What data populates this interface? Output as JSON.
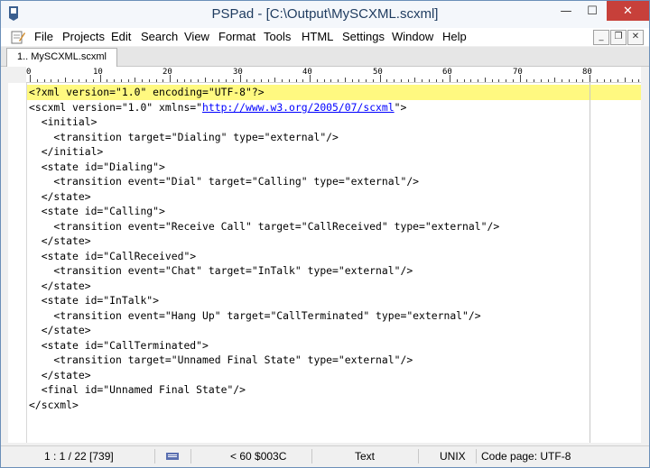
{
  "window": {
    "title": "PSPad - [C:\\Output\\MySCXML.scxml]"
  },
  "controls": {
    "minimize": "—",
    "maximize": "☐",
    "close": "✕"
  },
  "mdi_controls": {
    "minimize": "_",
    "restore": "❐",
    "close": "✕"
  },
  "menu": [
    "File",
    "Projects",
    "Edit",
    "Search",
    "View",
    "Format",
    "Tools",
    "HTML",
    "Settings",
    "Window",
    "Help"
  ],
  "tabs": [
    {
      "label": "1.. MySCXML.scxml"
    }
  ],
  "ruler": {
    "labels": [
      "0",
      "10",
      "20",
      "30",
      "40",
      "50",
      "60",
      "70",
      "80"
    ]
  },
  "code": {
    "lines": [
      "<?xml version=\"1.0\" encoding=\"UTF-8\"?>",
      "<scxml version=\"1.0\" xmlns=\"",
      "  <initial>",
      "    <transition target=\"Dialing\" type=\"external\"/>",
      "  </initial>",
      "  <state id=\"Dialing\">",
      "    <transition event=\"Dial\" target=\"Calling\" type=\"external\"/>",
      "  </state>",
      "  <state id=\"Calling\">",
      "    <transition event=\"Receive Call\" target=\"CallReceived\" type=\"external\"/>",
      "  </state>",
      "  <state id=\"CallReceived\">",
      "    <transition event=\"Chat\" target=\"InTalk\" type=\"external\"/>",
      "  </state>",
      "  <state id=\"InTalk\">",
      "    <transition event=\"Hang Up\" target=\"CallTerminated\" type=\"external\"/>",
      "  </state>",
      "  <state id=\"CallTerminated\">",
      "    <transition target=\"Unnamed Final State\" type=\"external\"/>",
      "  </state>",
      "  <final id=\"Unnamed Final State\"/>",
      "</scxml>"
    ],
    "link_text": "http://www.w3.org/2005/07/scxml",
    "link_suffix": "\">"
  },
  "status": {
    "position": "1 : 1 / 22 [739]",
    "char_info": "<   60  $003C",
    "mode": "Text",
    "line_endings": "UNIX",
    "code_page": "Code page: UTF-8"
  },
  "colors": {
    "current_line": "#fff980",
    "link": "#0000ff",
    "close_button": "#c7403a"
  }
}
